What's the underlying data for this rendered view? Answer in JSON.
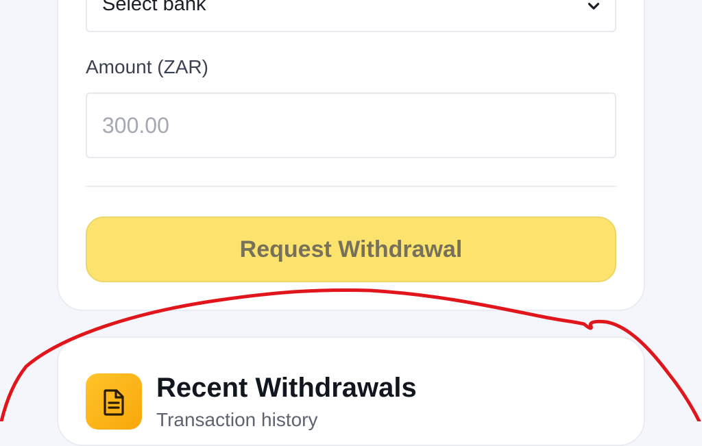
{
  "withdraw_form": {
    "bank_select": {
      "value": "Select bank",
      "icon": "chevron-down-icon"
    },
    "amount": {
      "label": "Amount (ZAR)",
      "placeholder": "300.00",
      "value": ""
    },
    "submit_label": "Request Withdrawal"
  },
  "recent_withdrawals": {
    "icon": "document-icon",
    "title": "Recent Withdrawals",
    "subtitle": "Transaction history"
  },
  "annotation": {
    "type": "hand-drawn-outline",
    "color": "#e0161c"
  },
  "colors": {
    "background": "#f4f6fb",
    "card": "#ffffff",
    "button_fill": "#fbe36e",
    "button_text": "#77715a",
    "icon_tile": "#fbb517"
  }
}
